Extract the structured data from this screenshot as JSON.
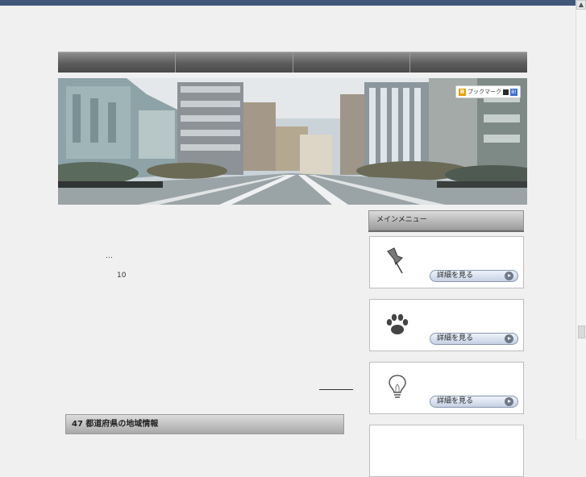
{
  "nav": {
    "items": [
      "",
      "",
      "",
      ""
    ]
  },
  "bookmark": {
    "icon_letter": "B",
    "label": "ブックマーク",
    "blue_icon_label": "B!"
  },
  "main": {
    "ellipsis": "…",
    "count": "10"
  },
  "prefectures": {
    "title": "47 都道府県の地域情報"
  },
  "sidebar": {
    "menu_title": "メインメニュー",
    "cards": [
      {
        "icon": "pushpin-icon",
        "button_label": "詳細を見る"
      },
      {
        "icon": "paw-icon",
        "button_label": "詳細を見る"
      },
      {
        "icon": "lightbulb-icon",
        "button_label": "詳細を見る"
      }
    ]
  },
  "colors": {
    "top_bar": "#40577a",
    "nav_dark": "#4a4a4a",
    "button_border": "#8796b0"
  }
}
